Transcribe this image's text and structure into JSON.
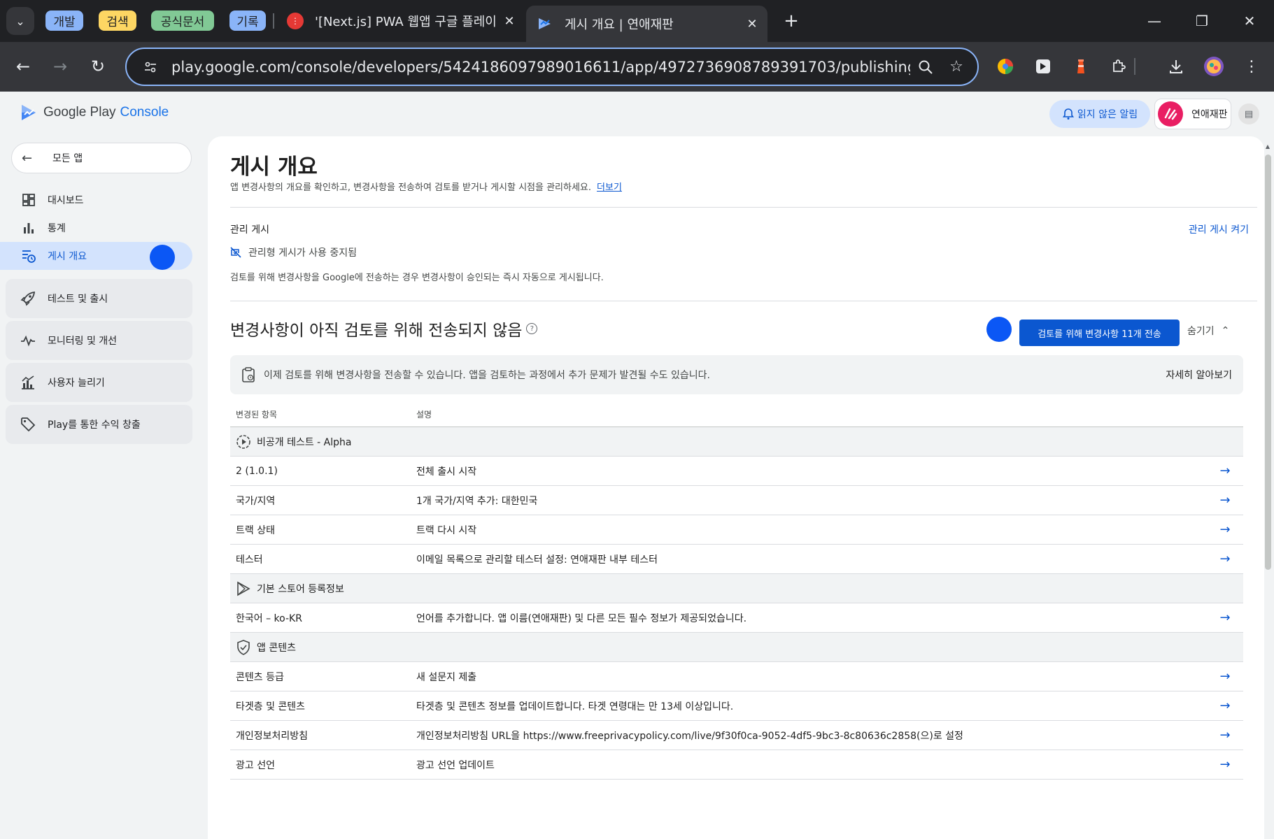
{
  "browser": {
    "tab_groups": [
      {
        "label": "개발",
        "color": "#8ab4f8"
      },
      {
        "label": "검색",
        "color": "#fdd663"
      },
      {
        "label": "공식문서",
        "color": "#81c995"
      },
      {
        "label": "기록",
        "color": "#8ab4f8"
      }
    ],
    "tabs": [
      {
        "title": "'[Next.js] PWA 웹앱 구글 플레이",
        "active": false
      },
      {
        "title": "게시 개요 | 연애재판",
        "active": true
      }
    ],
    "url": "play.google.com/console/developers/5424186097989016611/app/4972736908789391703/publishing"
  },
  "header": {
    "logo_google_play": "Google Play",
    "logo_console": "Console",
    "notif_label": "읽지 않은 알림",
    "account_name": "연애재판"
  },
  "sidebar": {
    "back_label": "모든 앱",
    "items": [
      {
        "label": "대시보드",
        "icon": "dashboard-icon"
      },
      {
        "label": "통계",
        "icon": "bar-chart-icon"
      },
      {
        "label": "게시 개요",
        "icon": "publishing-overview-icon",
        "active": true
      }
    ],
    "groups": [
      {
        "label": "테스트 및 출시",
        "icon": "rocket-icon"
      },
      {
        "label": "모니터링 및 개선",
        "icon": "vitals-icon"
      },
      {
        "label": "사용자 늘리기",
        "icon": "grow-chart-icon"
      },
      {
        "label": "Play를 통한 수익 창출",
        "icon": "tag-icon"
      }
    ]
  },
  "main": {
    "title": "게시 개요",
    "description": "앱 변경사항의 개요를 확인하고, 변경사항을 전송하여 검토를 받거나 게시할 시점을 관리하세요.",
    "learn_more": "더보기",
    "managed_publishing": {
      "title": "관리 게시",
      "enable_link": "관리 게시 켜기",
      "status": "관리형 게시가 사용 중지됨",
      "description": "검토를 위해 변경사항을 Google에 전송하는 경우 변경사항이 승인되는 즉시 자동으로 게시됩니다."
    },
    "changes_section": {
      "title": "변경사항이 아직 검토를 위해 전송되지 않음",
      "send_button": "검토를 위해 변경사항 11개 전송",
      "hide_button": "숨기기",
      "banner_text": "이제 검토를 위해 변경사항을 전송할 수 있습니다. 앱을 검토하는 과정에서 추가 문제가 발견될 수도 있습니다.",
      "banner_link": "자세히 알아보기"
    },
    "table": {
      "col_item": "변경된 항목",
      "col_desc": "설명",
      "groups": [
        {
          "name": "비공개 테스트 - Alpha",
          "icon": "closed-test-icon",
          "rows": [
            {
              "item": "2 (1.0.1)",
              "desc": "전체 출시 시작"
            },
            {
              "item": "국가/지역",
              "desc": "1개 국가/지역 추가: 대한민국"
            },
            {
              "item": "트랙 상태",
              "desc": "트랙 다시 시작"
            },
            {
              "item": "테스터",
              "desc": "이메일 목록으로 관리할 테스터 설정: 연애재판 내부 테스터"
            }
          ]
        },
        {
          "name": "기본 스토어 등록정보",
          "icon": "play-store-icon",
          "rows": [
            {
              "item": "한국어 – ko-KR",
              "desc": "언어를 추가합니다. 앱 이름(연애재판) 및 다른 모든 필수 정보가 제공되었습니다."
            }
          ]
        },
        {
          "name": "앱 콘텐츠",
          "icon": "shield-check-icon",
          "rows": [
            {
              "item": "콘텐츠 등급",
              "desc": "새 설문지 제출"
            },
            {
              "item": "타겟층 및 콘텐츠",
              "desc": "타겟층 및 콘텐츠 정보를 업데이트합니다. 타겟 연령대는 만 13세 이상입니다."
            },
            {
              "item": "개인정보처리방침",
              "desc": "개인정보처리방침 URL을 https://www.freeprivacypolicy.com/live/9f30f0ca-9052-4df5-9bc3-8c80636c2858(으)로 설정"
            },
            {
              "item": "광고 선언",
              "desc": "광고 선언 업데이트"
            }
          ]
        }
      ]
    }
  }
}
